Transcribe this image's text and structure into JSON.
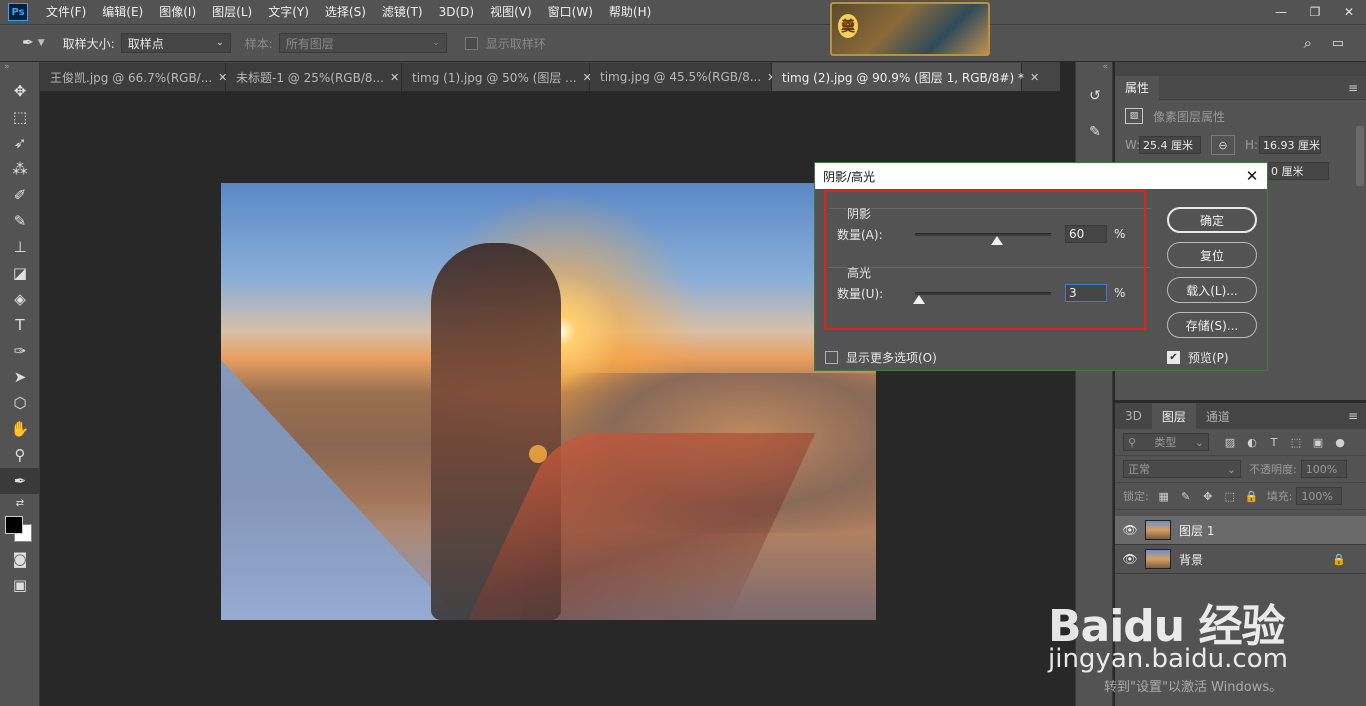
{
  "menubar": {
    "logo": "Ps",
    "items": [
      "文件(F)",
      "编辑(E)",
      "图像(I)",
      "图层(L)",
      "文字(Y)",
      "选择(S)",
      "滤镜(T)",
      "3D(D)",
      "视图(V)",
      "窗口(W)",
      "帮助(H)"
    ],
    "banner_text": "羹",
    "window_controls": [
      "—",
      "❐",
      "✕"
    ]
  },
  "options": {
    "sample_size_label": "取样大小:",
    "sample_size_value": "取样点",
    "sample_label": "样本:",
    "sample_value": "所有图层",
    "show_ring_label": "显示取样环"
  },
  "tabs": [
    {
      "label": "王俊凯.jpg @ 66.7%(RGB/...",
      "close": "✕"
    },
    {
      "label": "未标题-1 @ 25%(RGB/8...",
      "close": "✕"
    },
    {
      "label": "timg (1).jpg @ 50% (图层 ...",
      "close": "✕"
    },
    {
      "label": "timg.jpg @ 45.5%(RGB/8...",
      "close": "✕"
    },
    {
      "label": "timg (2).jpg @ 90.9% (图层 1, RGB/8#) *",
      "close": "✕"
    }
  ],
  "properties": {
    "tab": "属性",
    "title": "像素图层属性",
    "w_label": "W:",
    "w_value": "25.4 厘米",
    "h_label": "H:",
    "h_value": "16.93 厘米",
    "y_value": "0 厘米",
    "link_icon": "⊖"
  },
  "layers": {
    "tabs": [
      "3D",
      "图层",
      "通道"
    ],
    "filter_label": "类型",
    "blend_mode": "正常",
    "opacity_label": "不透明度:",
    "opacity_value": "100%",
    "lock_label": "锁定:",
    "fill_label": "填充:",
    "fill_value": "100%",
    "items": [
      {
        "name": "图层 1"
      },
      {
        "name": "背景"
      }
    ]
  },
  "dialog": {
    "title": "阴影/高光",
    "shadows": {
      "title": "阴影",
      "label": "数量(A):",
      "value": "60",
      "percent": 60,
      "unit": "%"
    },
    "highlights": {
      "title": "高光",
      "label": "数量(U):",
      "value": "3",
      "percent": 3,
      "unit": "%"
    },
    "buttons": {
      "ok": "确定",
      "reset": "复位",
      "load": "载入(L)...",
      "save": "存储(S)..."
    },
    "more_options": "显示更多选项(O)",
    "preview": "预览(P)"
  },
  "watermark": {
    "brand": "Baidu 经验",
    "url": "jingyan.baidu.com",
    "windows": "转到\"设置\"以激活 Windows。"
  }
}
